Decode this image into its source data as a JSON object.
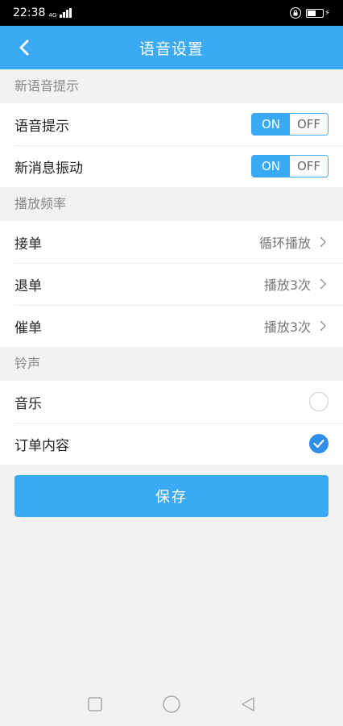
{
  "status_bar": {
    "time": "22:38",
    "network": "4G"
  },
  "nav": {
    "title": "语音设置"
  },
  "sections": {
    "new_voice": {
      "header": "新语音提示",
      "voice_prompt": {
        "label": "语音提示",
        "on": "ON",
        "off": "OFF",
        "state": "ON"
      },
      "vibrate": {
        "label": "新消息振动",
        "on": "ON",
        "off": "OFF",
        "state": "ON"
      }
    },
    "frequency": {
      "header": "播放频率",
      "accept": {
        "label": "接单",
        "value": "循环播放"
      },
      "refund": {
        "label": "退单",
        "value": "播放3次"
      },
      "remind": {
        "label": "催单",
        "value": "播放3次"
      }
    },
    "ringtone": {
      "header": "铃声",
      "music": {
        "label": "音乐",
        "selected": false
      },
      "order_content": {
        "label": "订单内容",
        "selected": true
      }
    }
  },
  "save_label": "保存",
  "colors": {
    "accent": "#3aaaf5",
    "check": "#2e8de6"
  }
}
